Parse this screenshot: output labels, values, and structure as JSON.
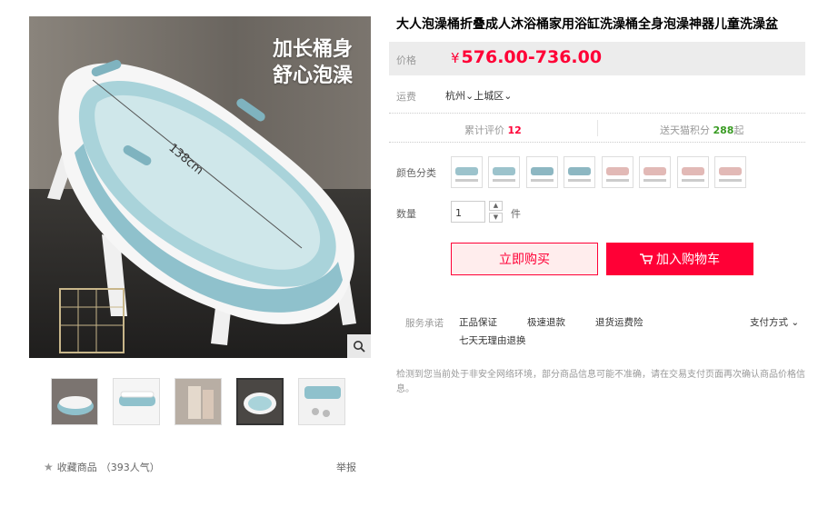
{
  "product": {
    "title": "大人泡澡桶折叠成人沐浴桶家用浴缸洗澡桶全身泡澡神器儿童洗澡盆",
    "image_headline_line1": "加长桶身",
    "image_headline_line2": "舒心泡澡",
    "image_length_label": "138cm"
  },
  "price": {
    "label": "价格",
    "currency": "¥",
    "range": "576.00-736.00"
  },
  "shipping": {
    "label": "运费",
    "location": "杭州",
    "district": "上城区"
  },
  "stats": {
    "reviews_label": "累计评价",
    "reviews_count": "12",
    "points_label": "送天猫积分",
    "points_value": "288",
    "points_unit": "起"
  },
  "options": {
    "color_label": "颜色分类",
    "swatch_colors": [
      "#9cc3cc",
      "#9cc3cc",
      "#8db7c2",
      "#8db7c2",
      "#e2b9b6",
      "#e2b9b6",
      "#e2b9b6",
      "#e2b9b6"
    ]
  },
  "quantity": {
    "label": "数量",
    "value": "1",
    "unit": "件"
  },
  "actions": {
    "buy_now": "立即购买",
    "add_to_cart": "加入购物车"
  },
  "services": {
    "label": "服务承诺",
    "items": [
      "正品保证",
      "极速退款",
      "退货运费险"
    ],
    "extra": "七天无理由退换",
    "payment": "支付方式"
  },
  "notice": "检测到您当前处于非安全网络环境，部分商品信息可能不准确，请在交易支付页面再次确认商品价格信息。",
  "gallery": {
    "thumb_count": 5,
    "active_index": 3
  },
  "footer": {
    "collect_label": "收藏商品",
    "popularity": "（393人气）",
    "report": "举报"
  },
  "colors": {
    "accent": "#ff0036",
    "tub_blue": "#8fc1cc"
  }
}
